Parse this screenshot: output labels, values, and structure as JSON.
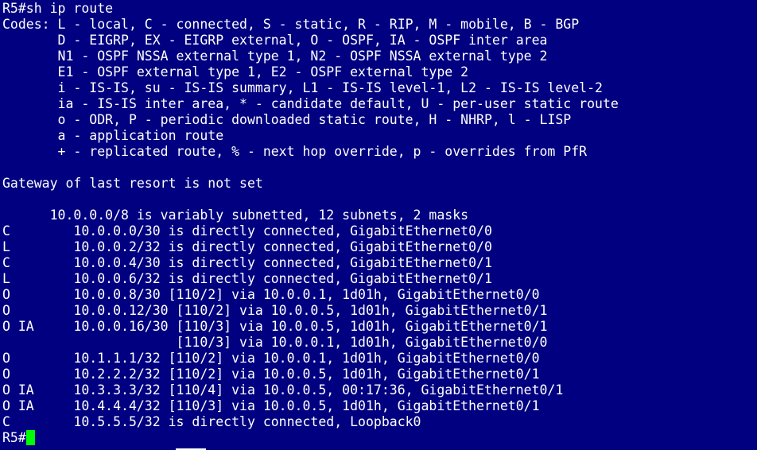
{
  "terminal": {
    "background": "#000080",
    "foreground": "#ffffff",
    "cursor_color": "#00ff00",
    "lines": [
      "R5#sh ip route",
      "Codes: L - local, C - connected, S - static, R - RIP, M - mobile, B - BGP",
      "       D - EIGRP, EX - EIGRP external, O - OSPF, IA - OSPF inter area",
      "       N1 - OSPF NSSA external type 1, N2 - OSPF NSSA external type 2",
      "       E1 - OSPF external type 1, E2 - OSPF external type 2",
      "       i - IS-IS, su - IS-IS summary, L1 - IS-IS level-1, L2 - IS-IS level-2",
      "       ia - IS-IS inter area, * - candidate default, U - per-user static route",
      "       o - ODR, P - periodic downloaded static route, H - NHRP, l - LISP",
      "       a - application route",
      "       + - replicated route, % - next hop override, p - overrides from PfR",
      "",
      "Gateway of last resort is not set",
      "",
      "      10.0.0.0/8 is variably subnetted, 12 subnets, 2 masks",
      "C        10.0.0.0/30 is directly connected, GigabitEthernet0/0",
      "L        10.0.0.2/32 is directly connected, GigabitEthernet0/0",
      "C        10.0.0.4/30 is directly connected, GigabitEthernet0/1",
      "L        10.0.0.6/32 is directly connected, GigabitEthernet0/1",
      "O        10.0.0.8/30 [110/2] via 10.0.0.1, 1d01h, GigabitEthernet0/0",
      "O        10.0.0.12/30 [110/2] via 10.0.0.5, 1d01h, GigabitEthernet0/1",
      "O IA     10.0.0.16/30 [110/3] via 10.0.0.5, 1d01h, GigabitEthernet0/1",
      "                      [110/3] via 10.0.0.1, 1d01h, GigabitEthernet0/0",
      "O        10.1.1.1/32 [110/2] via 10.0.0.1, 1d01h, GigabitEthernet0/0",
      "O        10.2.2.2/32 [110/2] via 10.0.0.5, 1d01h, GigabitEthernet0/1",
      "O IA     10.3.3.3/32 [110/4] via 10.0.0.5, 00:17:36, GigabitEthernet0/1",
      "O IA     10.4.4.4/32 [110/3] via 10.0.0.5, 1d01h, GigabitEthernet0/1",
      "C        10.5.5.5/32 is directly connected, Loopback0"
    ],
    "prompt": "R5#"
  }
}
